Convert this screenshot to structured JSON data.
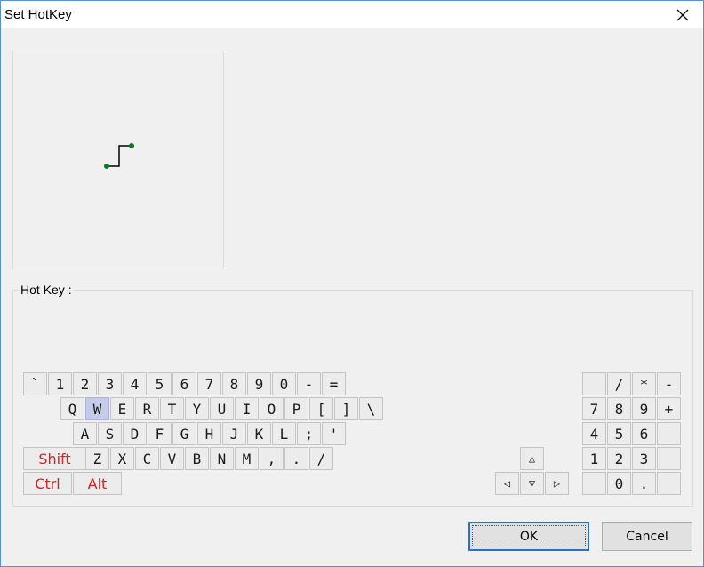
{
  "window": {
    "title": "Set HotKey"
  },
  "hotkey_group": {
    "label": "Hot Key :"
  },
  "icons": {
    "close": "close-icon",
    "gesture_preview": "gesture-stroke-icon"
  },
  "colors": {
    "active_key": "#c5cbe8",
    "modifier_text": "#e02020",
    "gesture_dot": "#0a7a2a"
  },
  "keyboard": {
    "row1": [
      "`",
      "1",
      "2",
      "3",
      "4",
      "5",
      "6",
      "7",
      "8",
      "9",
      "0",
      "-",
      "="
    ],
    "row2": [
      "Q",
      "W",
      "E",
      "R",
      "T",
      "Y",
      "U",
      "I",
      "O",
      "P",
      "[",
      "]",
      "\\"
    ],
    "row3": [
      "A",
      "S",
      "D",
      "F",
      "G",
      "H",
      "J",
      "K",
      "L",
      ";",
      "'"
    ],
    "row4": [
      "Z",
      "X",
      "C",
      "V",
      "B",
      "N",
      "M",
      ",",
      ".",
      "/"
    ],
    "modifiers": {
      "shift": "Shift",
      "ctrl": "Ctrl",
      "alt": "Alt"
    },
    "selected_key": "W",
    "arrows": {
      "up": "△",
      "left": "◁",
      "down": "▽",
      "right": "▷"
    },
    "numpad": [
      [
        "",
        "/",
        "*",
        "-"
      ],
      [
        "7",
        "8",
        "9",
        "+"
      ],
      [
        "4",
        "5",
        "6",
        ""
      ],
      [
        "1",
        "2",
        "3",
        ""
      ],
      [
        "",
        "0",
        ".",
        ""
      ]
    ]
  },
  "buttons": {
    "ok": "OK",
    "cancel": "Cancel"
  }
}
